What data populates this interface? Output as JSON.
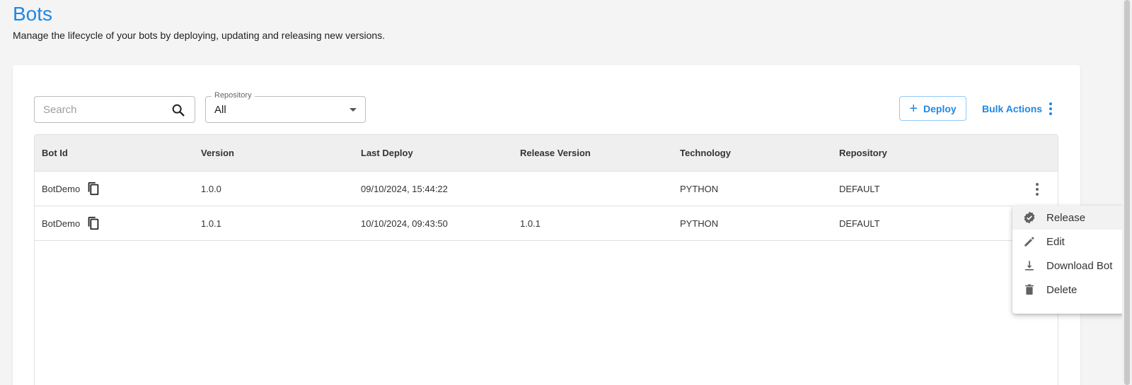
{
  "header": {
    "title": "Bots",
    "subtitle": "Manage the lifecycle of your bots by deploying, updating and releasing new versions."
  },
  "toolbar": {
    "search_placeholder": "Search",
    "repository_label": "Repository",
    "repository_value": "All",
    "deploy_label": "Deploy",
    "bulk_actions_label": "Bulk Actions"
  },
  "table": {
    "columns": [
      "Bot Id",
      "Version",
      "Last Deploy",
      "Release Version",
      "Technology",
      "Repository"
    ],
    "rows": [
      {
        "bot_id": "BotDemo",
        "version": "1.0.0",
        "last_deploy": "09/10/2024, 15:44:22",
        "release_version": "",
        "technology": "PYTHON",
        "repository": "DEFAULT"
      },
      {
        "bot_id": "BotDemo",
        "version": "1.0.1",
        "last_deploy": "10/10/2024, 09:43:50",
        "release_version": "1.0.1",
        "technology": "PYTHON",
        "repository": "DEFAULT"
      }
    ]
  },
  "context_menu": {
    "items": [
      {
        "label": "Release",
        "icon": "verified-badge-icon"
      },
      {
        "label": "Edit",
        "icon": "pencil-icon"
      },
      {
        "label": "Download Bot",
        "icon": "download-icon"
      },
      {
        "label": "Delete",
        "icon": "trash-icon"
      }
    ]
  },
  "colors": {
    "accent": "#1e88e5",
    "background": "#f4f4f4",
    "header_row": "#efefef"
  }
}
